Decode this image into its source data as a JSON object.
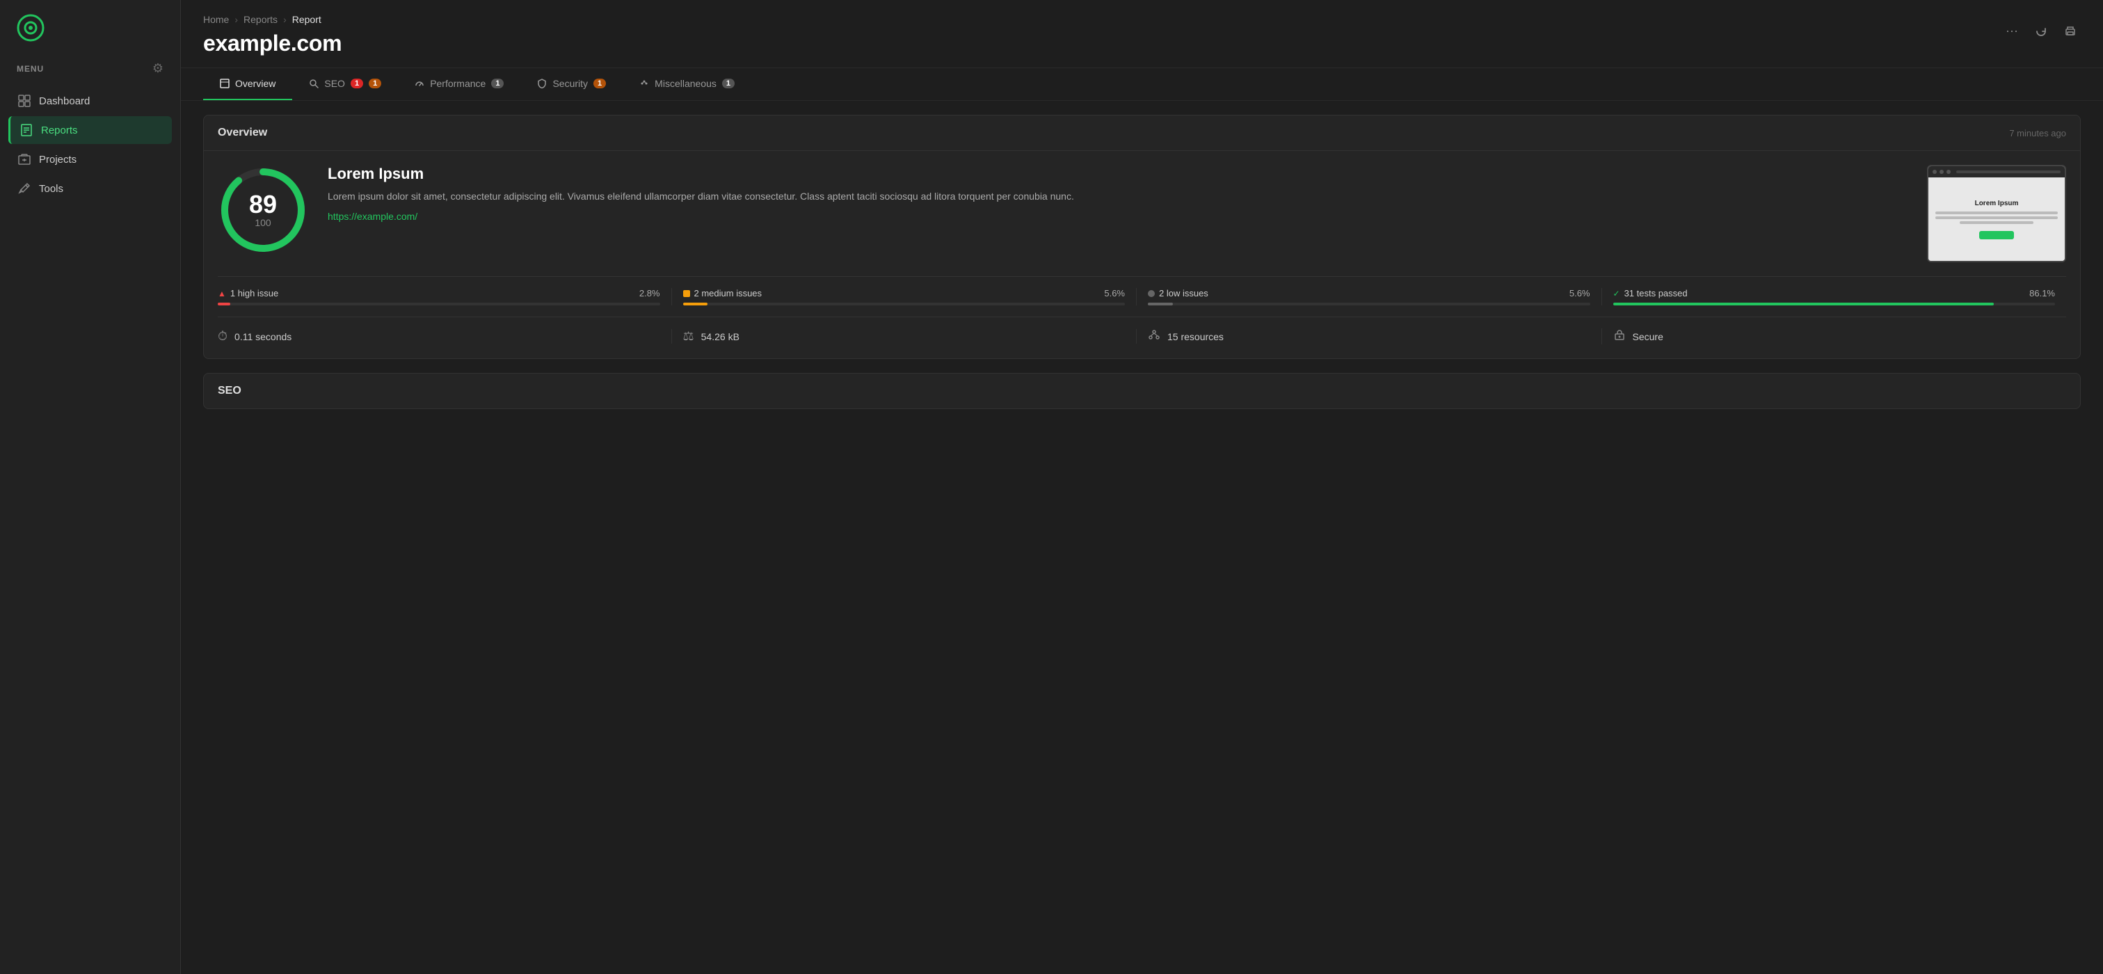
{
  "sidebar": {
    "menu_label": "MENU",
    "items": [
      {
        "id": "dashboard",
        "label": "Dashboard",
        "active": false
      },
      {
        "id": "reports",
        "label": "Reports",
        "active": true
      },
      {
        "id": "projects",
        "label": "Projects",
        "active": false
      },
      {
        "id": "tools",
        "label": "Tools",
        "active": false
      }
    ]
  },
  "header": {
    "breadcrumb": [
      {
        "label": "Home",
        "current": false
      },
      {
        "label": "Reports",
        "current": false
      },
      {
        "label": "Report",
        "current": true
      }
    ],
    "title": "example.com",
    "actions": [
      "more",
      "refresh",
      "print"
    ]
  },
  "tabs": [
    {
      "id": "overview",
      "label": "Overview",
      "badge": null,
      "active": true
    },
    {
      "id": "seo",
      "label": "SEO",
      "badge_red": "1",
      "badge_yellow": "1",
      "active": false
    },
    {
      "id": "performance",
      "label": "Performance",
      "badge_gray": "1",
      "active": false
    },
    {
      "id": "security",
      "label": "Security",
      "badge_yellow": "1",
      "active": false
    },
    {
      "id": "miscellaneous",
      "label": "Miscellaneous",
      "badge_gray": "1",
      "active": false
    }
  ],
  "overview_section": {
    "title": "Overview",
    "time_ago": "7 minutes ago",
    "score": {
      "value": "89",
      "max": "100",
      "percent": 89
    },
    "site_name": "Lorem Ipsum",
    "description": "Lorem ipsum dolor sit amet, consectetur adipiscing elit. Vivamus eleifend ullamcorper diam vitae consectetur. Class aptent taciti sociosqu ad litora torquent per conubia nunc.",
    "url": "https://example.com/",
    "issues": [
      {
        "id": "high",
        "label": "1 high issue",
        "pct": "2.8%",
        "pct_val": 2.8,
        "color": "red",
        "type": "triangle"
      },
      {
        "id": "medium",
        "label": "2 medium issues",
        "pct": "5.6%",
        "pct_val": 5.6,
        "color": "yellow",
        "type": "square"
      },
      {
        "id": "low",
        "label": "2 low issues",
        "pct": "5.6%",
        "pct_val": 5.6,
        "color": "gray",
        "type": "circle"
      },
      {
        "id": "passed",
        "label": "31 tests passed",
        "pct": "86.1%",
        "pct_val": 86.1,
        "color": "green",
        "type": "check"
      }
    ],
    "stats": [
      {
        "id": "time",
        "icon": "⏱",
        "value": "0.11 seconds"
      },
      {
        "id": "size",
        "icon": "⚖",
        "value": "54.26 kB"
      },
      {
        "id": "resources",
        "icon": "🔗",
        "value": "15 resources"
      },
      {
        "id": "security",
        "icon": "🔒",
        "value": "Secure"
      }
    ],
    "preview": {
      "title": "Lorem Ipsum"
    }
  },
  "seo_section": {
    "title": "SEO"
  }
}
